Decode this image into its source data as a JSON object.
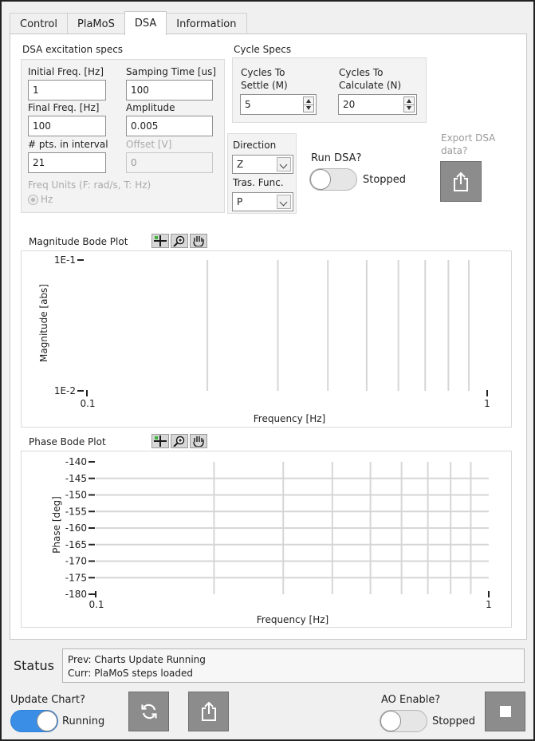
{
  "tabs": [
    {
      "label": "Control"
    },
    {
      "label": "PlaMoS"
    },
    {
      "label": "DSA"
    },
    {
      "label": "Information"
    }
  ],
  "excitation": {
    "title": "DSA excitation specs",
    "initial_freq_label": "Initial Freq. [Hz]",
    "initial_freq_value": "1",
    "sampling_time_label": "Samping Time [us]",
    "sampling_time_value": "100",
    "final_freq_label": "Final Freq. [Hz]",
    "final_freq_value": "100",
    "amplitude_label": "Amplitude",
    "amplitude_value": "0.005",
    "pts_label": "# pts. in interval",
    "pts_value": "21",
    "offset_label": "Offset [V]",
    "offset_value": "0",
    "freq_units_label": "Freq Units (F: rad/s, T: Hz)",
    "freq_units_option": "Hz"
  },
  "cycle": {
    "title": "Cycle Specs",
    "settle_label_1": "Cycles To",
    "settle_label_2": "Settle (M)",
    "settle_value": "5",
    "calc_label_1": "Cycles To",
    "calc_label_2": "Calculate (N)",
    "calc_value": "20"
  },
  "direction": {
    "label": "Direction",
    "value": "Z",
    "tras_label": "Tras. Func.",
    "tras_value": "P"
  },
  "run_dsa": {
    "label": "Run DSA?",
    "state": "Stopped"
  },
  "export": {
    "label_1": "Export DSA",
    "label_2": "data?"
  },
  "magnitude_plot": {
    "title": "Magnitude Bode Plot",
    "ylabel": "Magnitude [abs]",
    "xlabel": "Frequency  [Hz]",
    "y_ticks": [
      "1E-1",
      "1E-2"
    ],
    "x_ticks": [
      "0.1",
      "1"
    ]
  },
  "phase_plot": {
    "title": "Phase Bode Plot",
    "ylabel": "Phase [deg]",
    "xlabel": "Frequency  [Hz]",
    "y_ticks": [
      "-140",
      "-145",
      "-150",
      "-155",
      "-160",
      "-165",
      "-170",
      "-175",
      "-180"
    ],
    "x_ticks": [
      "0.1",
      "1"
    ]
  },
  "status": {
    "label": "Status",
    "prev": "Prev: Charts Update Running",
    "curr": "Curr: PlaMoS steps loaded"
  },
  "footer": {
    "update_label": "Update Chart?",
    "update_state": "Running",
    "ao_label": "AO Enable?",
    "ao_state": "Stopped"
  },
  "colors": {
    "toggle_on": "#3a8ee6",
    "button_gray": "#8c8c8c",
    "grid": "#d6d6d6"
  }
}
